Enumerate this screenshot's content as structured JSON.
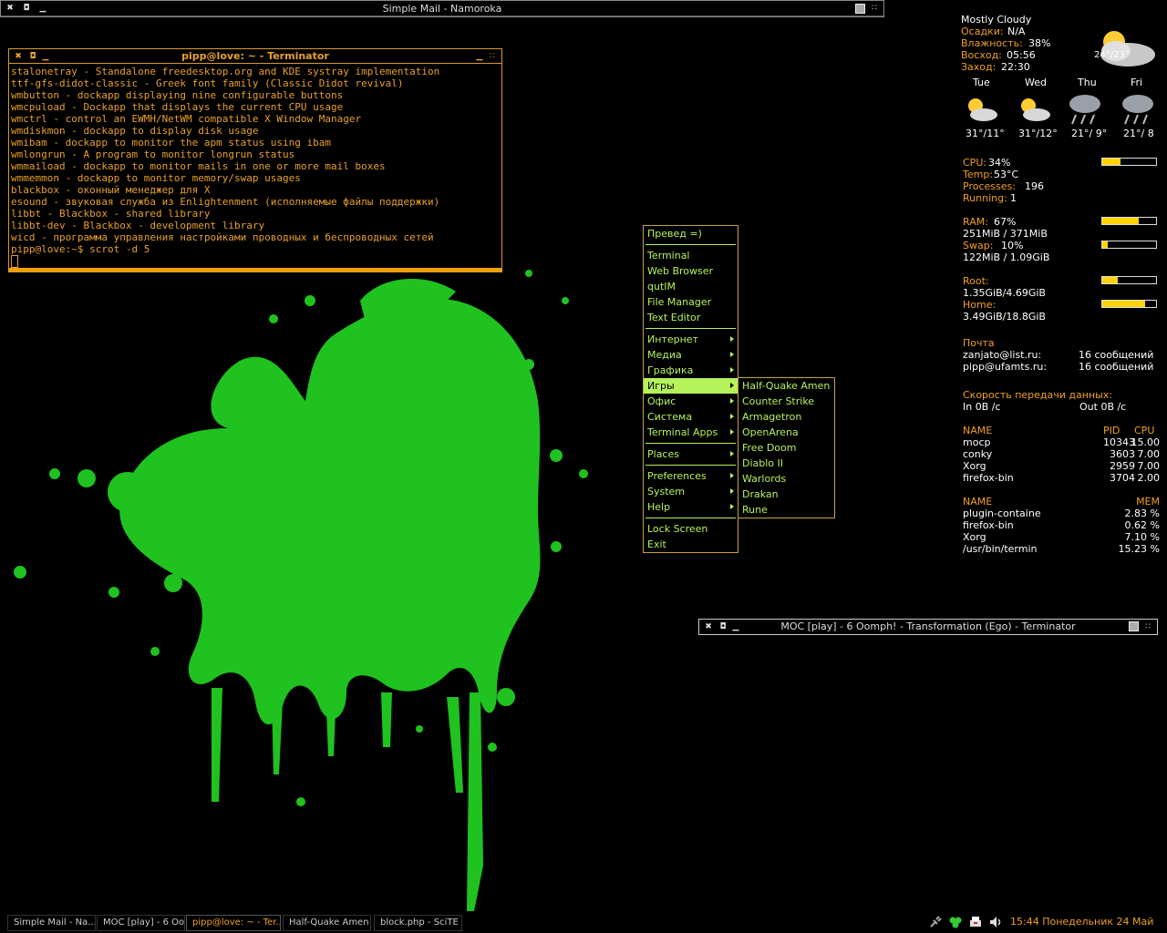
{
  "colors": {
    "accent": "#f0a020",
    "menu_text": "#b6f25a",
    "wallpaper_green": "#1fc21f",
    "bar_fill": "#ffd400"
  },
  "mail_window": {
    "title": "Simple Mail - Namoroka"
  },
  "terminal": {
    "title": "pipp@love: ~ - Terminator",
    "lines": [
      "stalonetray - Standalone freedesktop.org and KDE systray implementation",
      "ttf-gfs-didot-classic - Greek font family (Classic Didot revival)",
      "wmbutton - dockapp displaying nine configurable buttons",
      "wmcpuload - Dockapp that displays the current CPU usage",
      "wmctrl - control an EWMH/NetWM compatible X Window Manager",
      "wmdiskmon - dockapp to display disk usage",
      "wmibam - dockapp to monitor the apm status using ibam",
      "wmlongrun - A program to monitor longrun status",
      "wmmaiload - dockapp to monitor mails in one or more mail boxes",
      "wmmemmon - dockapp to monitor memory/swap usages",
      "blackbox - оконный менеджер для X",
      "esound - звуковая служба из Enlightenment (исполняемые файлы поддержки)",
      "libbt - Blackbox - shared library",
      "libbt-dev - Blackbox - development library",
      "wicd - программа управления настройками проводных и беспроводных сетей",
      "pipp@love:~$ scrot -d 5"
    ]
  },
  "moc_window": {
    "title": "MOC [play] - 6 Oomph! - Transformation (Ego) - Terminator"
  },
  "root_menu": {
    "header": "Превед =)",
    "group1": [
      "Terminal",
      "Web Browser",
      "qutIM",
      "File Manager",
      "Text Editor"
    ],
    "group2": [
      "Интернет",
      "Медиа",
      "Графика",
      "Игры",
      "Офис",
      "Система",
      "Terminal Apps"
    ],
    "group3": [
      "Places"
    ],
    "group4": [
      "Preferences",
      "System",
      "Help"
    ],
    "group5": [
      "Lock Screen",
      "Exit"
    ],
    "selected": "Игры"
  },
  "games_menu": {
    "items": [
      "Half-Quake Amen",
      "Counter Strike",
      "Armagetron",
      "OpenArena",
      "Free Doom",
      "Diablo II",
      "Warlords",
      "Drakan",
      "Rune"
    ]
  },
  "conky": {
    "weather": {
      "condition": "Mostly Cloudy",
      "precip_label": "Осадки:",
      "precip": "N/A",
      "humidity_label": "Влажность:",
      "humidity": "38%",
      "sunrise_label": "Восход:",
      "sunrise": "05:56",
      "sunset_label": "Заход:",
      "sunset": "22:30",
      "current_temp": "24°/23°",
      "days": [
        {
          "name": "Tue",
          "temp": "31°/11°",
          "icon": "partly-sunny-icon"
        },
        {
          "name": "Wed",
          "temp": "31°/12°",
          "icon": "partly-sunny-icon"
        },
        {
          "name": "Thu",
          "temp": "21°/ 9°",
          "icon": "rain-cloud-icon"
        },
        {
          "name": "Fri",
          "temp": "21°/ 8",
          "icon": "rain-cloud-icon"
        }
      ]
    },
    "cpu": {
      "cpu_label": "CPU:",
      "cpu": "34%",
      "cpu_frac": 0.34,
      "temp_label": "Temp:",
      "temp": "53°C",
      "processes_label": "Processes:",
      "processes": "196",
      "running_label": "Running:",
      "running": "1"
    },
    "mem": {
      "ram_label": "RAM:",
      "ram": "67%",
      "ram_frac": 0.67,
      "ram_detail": "251MiB / 371MiB",
      "swap_label": "Swap:",
      "swap": "10%",
      "swap_frac": 0.1,
      "swap_detail": "122MiB / 1.09GiB"
    },
    "disk": {
      "root_label": "Root:",
      "root_detail": "1.35GiB/4.69GiB",
      "root_frac": 0.29,
      "home_label": "Home:",
      "home_detail": "3.49GiB/18.8GiB",
      "home_frac": 0.8
    },
    "mail": {
      "label": "Почта",
      "accounts": [
        {
          "name": "zanjato@list.ru:",
          "count": "16 сообщений"
        },
        {
          "name": "pipp@ufamts.ru:",
          "count": "16 сообщений"
        }
      ]
    },
    "net": {
      "label": "Скорость передачи данных:",
      "in": "In 0B  /c",
      "out": "Out 0B  /c"
    },
    "top_cpu": {
      "headers": [
        "NAME",
        "PID",
        "CPU"
      ],
      "rows": [
        [
          "mocp",
          "10343",
          "15.00"
        ],
        [
          "conky",
          "3603",
          "7.00"
        ],
        [
          "Xorg",
          "2959",
          "7.00"
        ],
        [
          "firefox-bin",
          "3704",
          "2.00"
        ]
      ]
    },
    "top_mem": {
      "headers": [
        "NAME",
        "MEM"
      ],
      "rows": [
        [
          "plugin-containe",
          "2.83 %"
        ],
        [
          "firefox-bin",
          "0.62 %"
        ],
        [
          "Xorg",
          "7.10 %"
        ],
        [
          "/usr/bin/termin",
          "15.23 %"
        ]
      ]
    }
  },
  "taskbar": {
    "tasks": [
      {
        "label": "Simple Mail - Na...",
        "active": false
      },
      {
        "label": "MOC [play] - 6 Oo...",
        "active": false
      },
      {
        "label": "pipp@love: ~ - Ter...",
        "active": true
      },
      {
        "label": "Half-Quake Amen",
        "active": false
      },
      {
        "label": "block.php - SciTE",
        "active": false
      }
    ],
    "clock": "15:44 Понедельник 24 Май",
    "tray_icons": [
      "network-plug-icon",
      "clover-icon",
      "printer-icon",
      "volume-icon"
    ]
  }
}
